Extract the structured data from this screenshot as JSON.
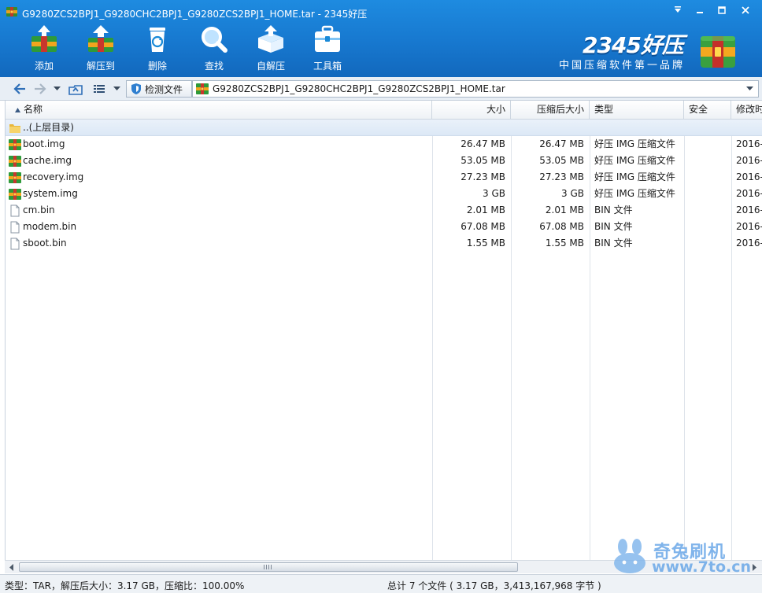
{
  "window": {
    "title": "G9280ZCS2BPJ1_G9280CHC2BPJ1_G9280ZCS2BPJ1_HOME.tar - 2345好压"
  },
  "toolbar": {
    "items": [
      {
        "label": "添加",
        "icon": "add-archive-icon"
      },
      {
        "label": "解压到",
        "icon": "extract-to-icon"
      },
      {
        "label": "删除",
        "icon": "recycle-bin-icon"
      },
      {
        "label": "查找",
        "icon": "magnifier-icon"
      },
      {
        "label": "自解压",
        "icon": "self-extract-icon"
      },
      {
        "label": "工具箱",
        "icon": "toolbox-icon"
      }
    ]
  },
  "brand": {
    "name": "2345好压",
    "slogan": "中国压缩软件第一品牌"
  },
  "address": {
    "detect_label": "检测文件",
    "path": "G9280ZCS2BPJ1_G9280CHC2BPJ1_G9280ZCS2BPJ1_HOME.tar"
  },
  "columns": [
    {
      "key": "name",
      "label": "名称"
    },
    {
      "key": "size",
      "label": "大小"
    },
    {
      "key": "packed",
      "label": "压缩后大小"
    },
    {
      "key": "type",
      "label": "类型"
    },
    {
      "key": "security",
      "label": "安全"
    },
    {
      "key": "modified",
      "label": "修改时"
    }
  ],
  "parent_row": {
    "name": "..(上层目录)"
  },
  "files": [
    {
      "name": "boot.img",
      "size": "26.47 MB",
      "packed": "26.47 MB",
      "type": "好压 IMG 压缩文件",
      "security": "",
      "modified": "2016-",
      "icon": "archive-icon"
    },
    {
      "name": "cache.img",
      "size": "53.05 MB",
      "packed": "53.05 MB",
      "type": "好压 IMG 压缩文件",
      "security": "",
      "modified": "2016-",
      "icon": "archive-icon"
    },
    {
      "name": "recovery.img",
      "size": "27.23 MB",
      "packed": "27.23 MB",
      "type": "好压 IMG 压缩文件",
      "security": "",
      "modified": "2016-",
      "icon": "archive-icon"
    },
    {
      "name": "system.img",
      "size": "3 GB",
      "packed": "3 GB",
      "type": "好压 IMG 压缩文件",
      "security": "",
      "modified": "2016-",
      "icon": "archive-icon"
    },
    {
      "name": "cm.bin",
      "size": "2.01 MB",
      "packed": "2.01 MB",
      "type": "BIN 文件",
      "security": "",
      "modified": "2016-",
      "icon": "file-icon"
    },
    {
      "name": "modem.bin",
      "size": "67.08 MB",
      "packed": "67.08 MB",
      "type": "BIN 文件",
      "security": "",
      "modified": "2016-",
      "icon": "file-icon"
    },
    {
      "name": "sboot.bin",
      "size": "1.55 MB",
      "packed": "1.55 MB",
      "type": "BIN 文件",
      "security": "",
      "modified": "2016-",
      "icon": "file-icon"
    }
  ],
  "status": {
    "left": "类型：TAR，解压后大小：3.17 GB，压缩比：100.00%",
    "middle": "总计 7 个文件 ( 3.17 GB，3,413,167,968 字节 )"
  },
  "watermark": {
    "name": "奇兔刷机",
    "url": "www.7to.cn"
  },
  "colors": {
    "title_blue": "#1778cf",
    "row_highlight": "#dce8f6"
  }
}
